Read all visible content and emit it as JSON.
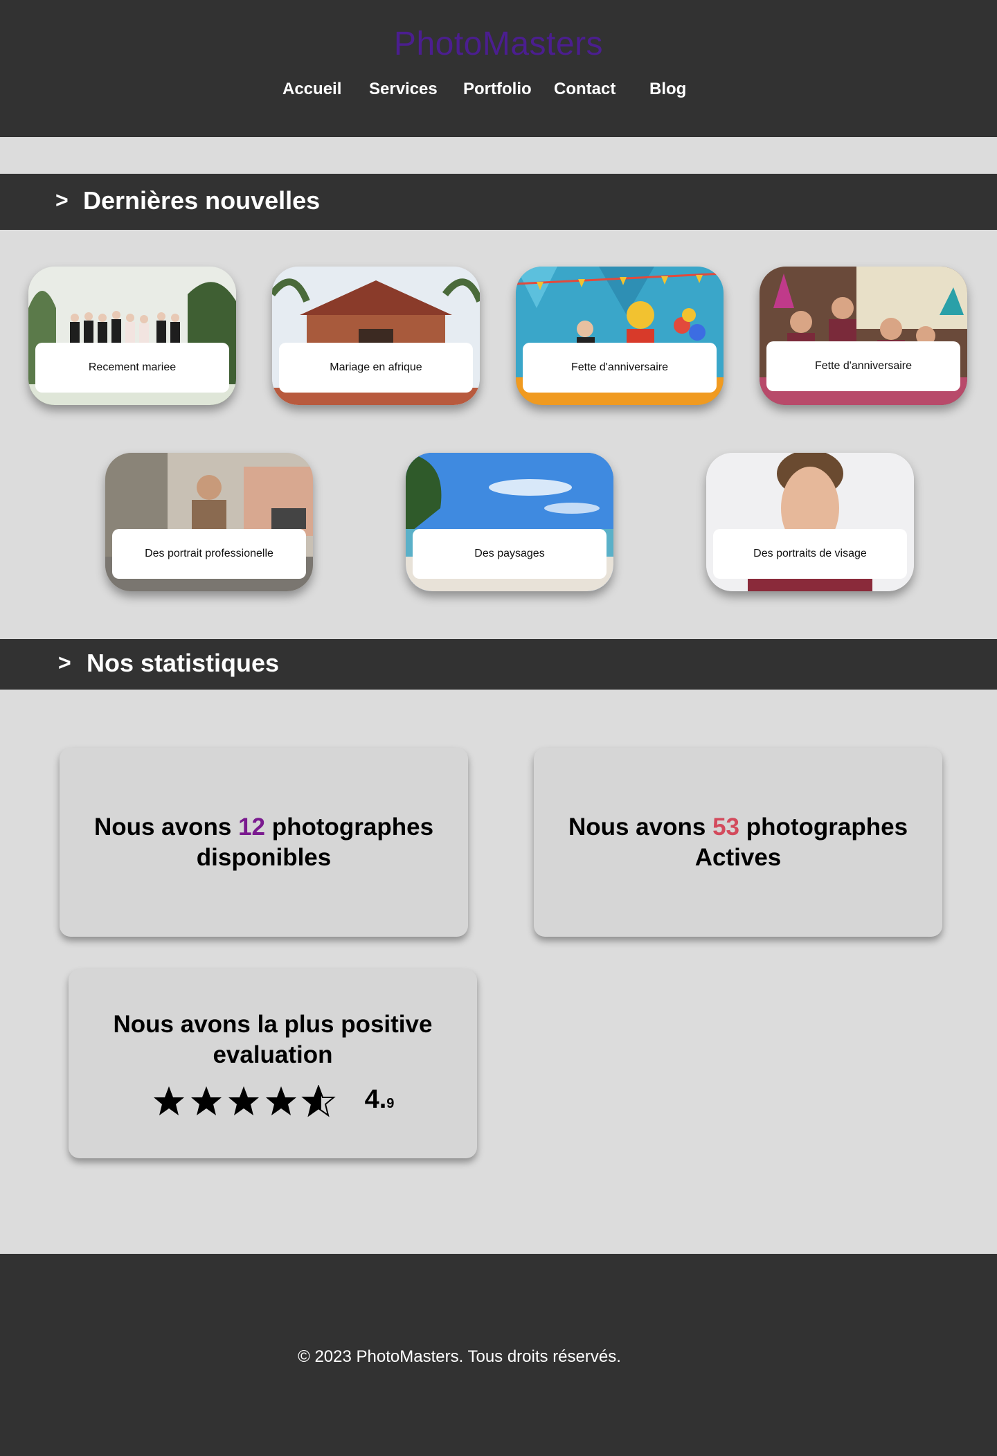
{
  "header": {
    "logo": "PhotoMasters",
    "nav": [
      "Accueil",
      "Services",
      "Portfolio",
      "Contact",
      "Blog"
    ]
  },
  "news": {
    "chevron": ">",
    "title": "Dernières nouvelles",
    "cards": [
      {
        "label": "Recement mariee",
        "scene": "wedding-party-garden"
      },
      {
        "label": "Mariage en afrique",
        "scene": "african-wedding-church"
      },
      {
        "label": "Fette d'anniversaire",
        "scene": "kids-birthday-party"
      },
      {
        "label": "Fette d'anniversaire",
        "scene": "birthday-celebration-hats"
      },
      {
        "label": "Des portrait professionelle",
        "scene": "man-street-portrait"
      },
      {
        "label": "Des paysages",
        "scene": "tropical-beach"
      },
      {
        "label": "Des portraits de visage",
        "scene": "face-portrait"
      }
    ]
  },
  "stats": {
    "chevron": ">",
    "title": "Nos statistiques",
    "box1": {
      "prefix": "Nous avons",
      "number": "12",
      "middle": "photographes",
      "suffix": "disponibles"
    },
    "box2": {
      "prefix": "Nous avons",
      "number": "53",
      "middle": "photographes",
      "suffix": "Actives"
    },
    "box3": {
      "text_line1": "Nous avons la plus positive",
      "text_line2": "evaluation",
      "stars": 4.5,
      "rating_main": "4.",
      "rating_small": "9"
    }
  },
  "footer": {
    "copyright": "© 2023 PhotoMasters. Tous droits réservés."
  },
  "colors": {
    "dark_bg": "#323232",
    "page_bg": "#dcdcdc",
    "logo": "#4b1e8f",
    "purple_number": "#7a1a8f",
    "red_number": "#d34a5c"
  }
}
